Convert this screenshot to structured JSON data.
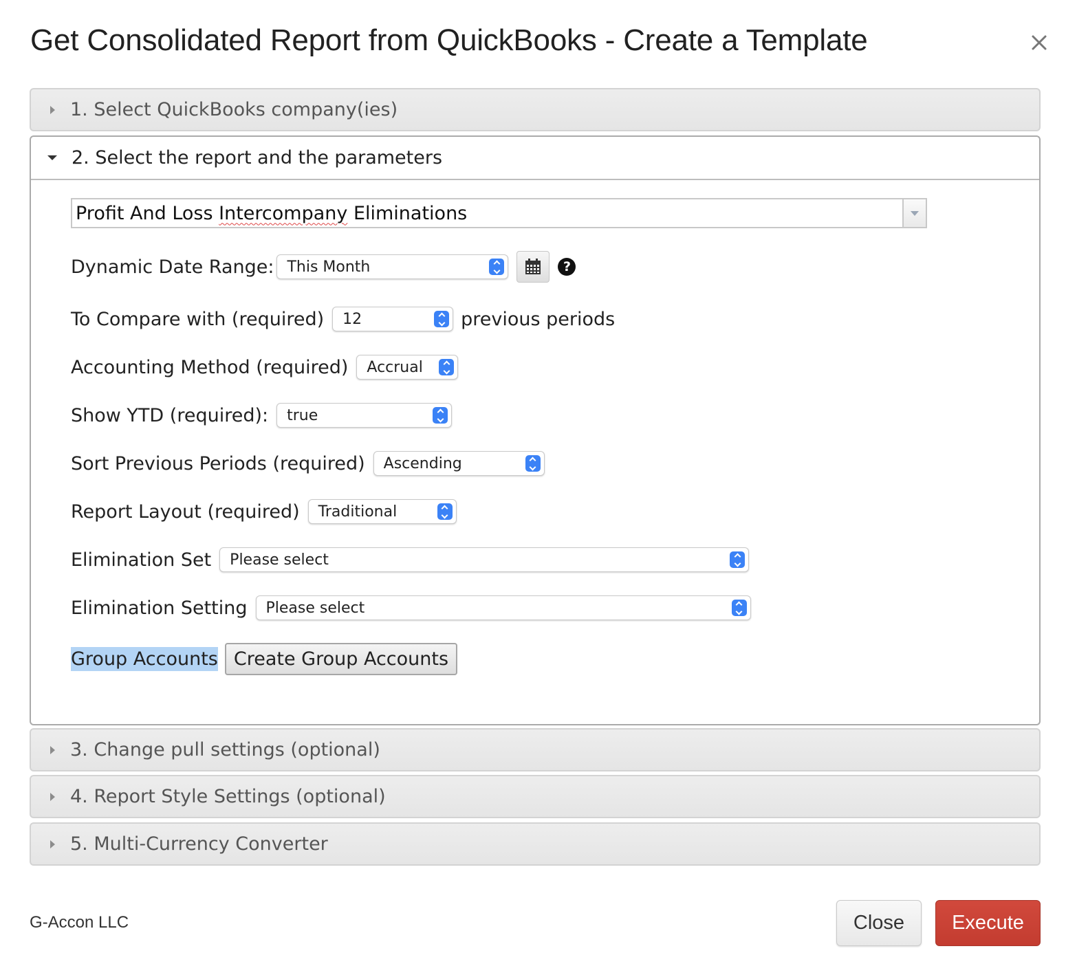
{
  "dialog": {
    "title": "Get Consolidated Report from QuickBooks - Create a Template"
  },
  "sections": {
    "s1": "1. Select QuickBooks company(ies)",
    "s2": "2. Select the report and the parameters",
    "s3": "3. Change pull settings (optional)",
    "s4": "4. Report Style Settings (optional)",
    "s5": "5. Multi-Currency Converter"
  },
  "report": {
    "prefix": "Profit And Loss ",
    "misspelled": "Intercompany",
    "suffix": " Eliminations"
  },
  "params": {
    "date_range": {
      "label": "Dynamic Date Range:",
      "value": "This Month"
    },
    "compare": {
      "label": "To Compare with (required)",
      "value": "12",
      "suffix": "previous periods"
    },
    "method": {
      "label": "Accounting Method (required)",
      "value": "Accrual"
    },
    "ytd": {
      "label": "Show YTD (required):",
      "value": "true"
    },
    "sort": {
      "label": "Sort Previous Periods (required)",
      "value": "Ascending"
    },
    "layout": {
      "label": "Report Layout (required)",
      "value": "Traditional"
    },
    "elim_set": {
      "label": "Elimination Set",
      "value": "Please select"
    },
    "elim_setting": {
      "label": "Elimination Setting",
      "value": "Please select"
    },
    "group": {
      "label": "Group Accounts",
      "button": "Create Group Accounts"
    }
  },
  "help_glyph": "?",
  "footer": {
    "company": "G-Accon LLC",
    "close_label": "Close",
    "execute_label": "Execute"
  },
  "colors": {
    "execute_button": "#c94236",
    "select_spinner": "#3b82f6",
    "highlight": "#b3d4f5"
  }
}
